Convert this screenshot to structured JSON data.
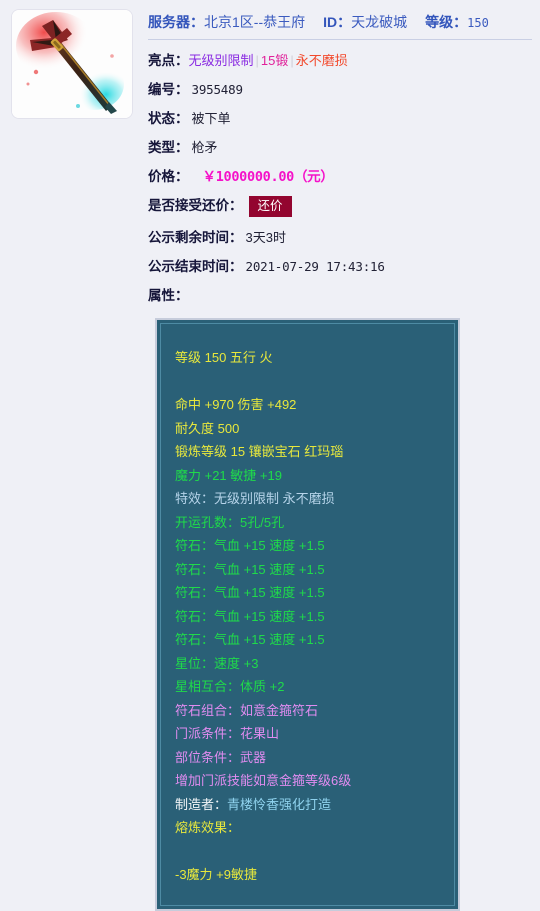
{
  "header": {
    "server_label": "服务器：",
    "server_value": "北京1区--恭王府",
    "id_label": "ID：",
    "id_value": "天龙破城",
    "level_label": "等级：",
    "level_value": "150"
  },
  "details": {
    "highlight_label": "亮点：",
    "highlight_tags": [
      {
        "text": "无级别限制",
        "color": "#8a2be2"
      },
      {
        "text": "15锻",
        "color": "#e0219a"
      },
      {
        "text": "永不磨损",
        "color": "#f2492c"
      }
    ],
    "id_number_label": "编号：",
    "id_number_value": "3955489",
    "status_label": "状态：",
    "status_value": "被下单",
    "type_label": "类型：",
    "type_value": "枪矛",
    "price_label": "价格：",
    "price_value": "￥1000000.00（元）",
    "bargain_label": "是否接受还价：",
    "bargain_button": "还价",
    "remaining_label": "公示剩余时间：",
    "remaining_value": "3天3时",
    "end_label": "公示结束时间：",
    "end_value": "2021-07-29 17:43:16",
    "attributes_label": "属性："
  },
  "item_image": {
    "name": "spear-weapon-thumbnail",
    "alt": "红色枪矛武器图标"
  },
  "attributes": {
    "lines": [
      {
        "id": "level-element",
        "color": "yellow",
        "text": "等级  150  五行  火"
      },
      {
        "id": "spacer-1",
        "color": "blank",
        "text": ""
      },
      {
        "id": "hit-damage",
        "color": "yellow",
        "text": "命中 +970  伤害 +492"
      },
      {
        "id": "durability",
        "color": "yellow",
        "text": "耐久度  500"
      },
      {
        "id": "forge-gem",
        "color": "yellow",
        "text": "锻炼等级  15  镶嵌宝石  红玛瑙"
      },
      {
        "id": "magic-agility",
        "color": "green",
        "text": "魔力 +21  敏捷 +19"
      },
      {
        "id": "special-effect",
        "color": "paleblue",
        "text": "特效：无级别限制  永不磨损"
      },
      {
        "id": "socket-count",
        "color": "green",
        "text": "开运孔数：5孔/5孔"
      },
      {
        "id": "rune-stone-1",
        "color": "green",
        "text": "符石：气血 +15  速度 +1.5"
      },
      {
        "id": "rune-stone-2",
        "color": "green",
        "text": "符石：气血 +15  速度 +1.5"
      },
      {
        "id": "rune-stone-3",
        "color": "green",
        "text": "符石：气血 +15  速度 +1.5"
      },
      {
        "id": "rune-stone-4",
        "color": "green",
        "text": "符石：气血 +15  速度 +1.5"
      },
      {
        "id": "rune-stone-5",
        "color": "green",
        "text": "符石：气血 +15  速度 +1.5"
      },
      {
        "id": "star-position",
        "color": "green",
        "text": "星位：速度 +3"
      },
      {
        "id": "star-harmony",
        "color": "green",
        "text": "星相互合：体质 +2"
      },
      {
        "id": "rune-combo",
        "color": "orchid",
        "text": "符石组合：如意金箍符石"
      },
      {
        "id": "sect-requirement",
        "color": "orchid",
        "text": "门派条件：花果山"
      },
      {
        "id": "slot-requirement",
        "color": "orchid",
        "text": "部位条件：武器"
      },
      {
        "id": "sect-skill-bonus",
        "color": "orchid",
        "text": "增加门派技能如意金箍等级6级"
      },
      {
        "id": "maker",
        "color": "maker",
        "text": "制造者：青楼怜香强化打造",
        "prefix": "制造者：",
        "suffix": "青楼怜香强化打造"
      },
      {
        "id": "smelt-effect-title",
        "color": "yellow",
        "text": "熔炼效果："
      },
      {
        "id": "spacer-2",
        "color": "blank",
        "text": ""
      },
      {
        "id": "smelt-effect-value",
        "color": "yellow",
        "text": "-3魔力  +9敏捷"
      }
    ]
  }
}
